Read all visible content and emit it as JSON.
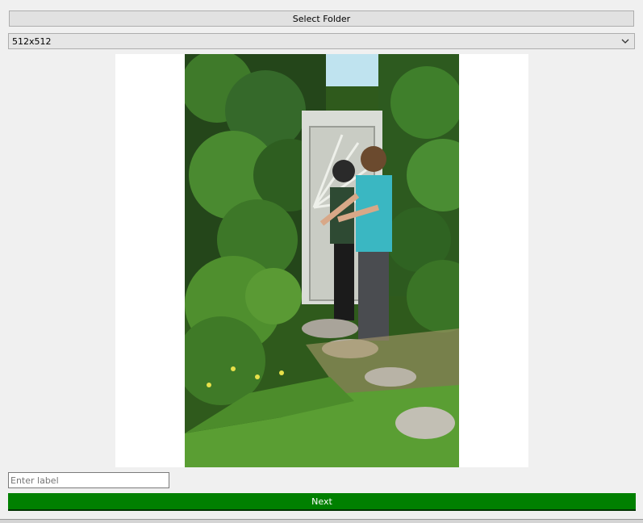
{
  "toolbar": {
    "select_folder_label": "Select Folder"
  },
  "size_dropdown": {
    "selected": "512x512",
    "icon": "chevron-down-icon"
  },
  "preview": {
    "image_description": "photo"
  },
  "label_input": {
    "value": "",
    "placeholder": "Enter label"
  },
  "actions": {
    "next_label": "Next"
  },
  "colors": {
    "background": "#f0f0f0",
    "next_button": "#008000",
    "next_text": "#ffffff"
  }
}
